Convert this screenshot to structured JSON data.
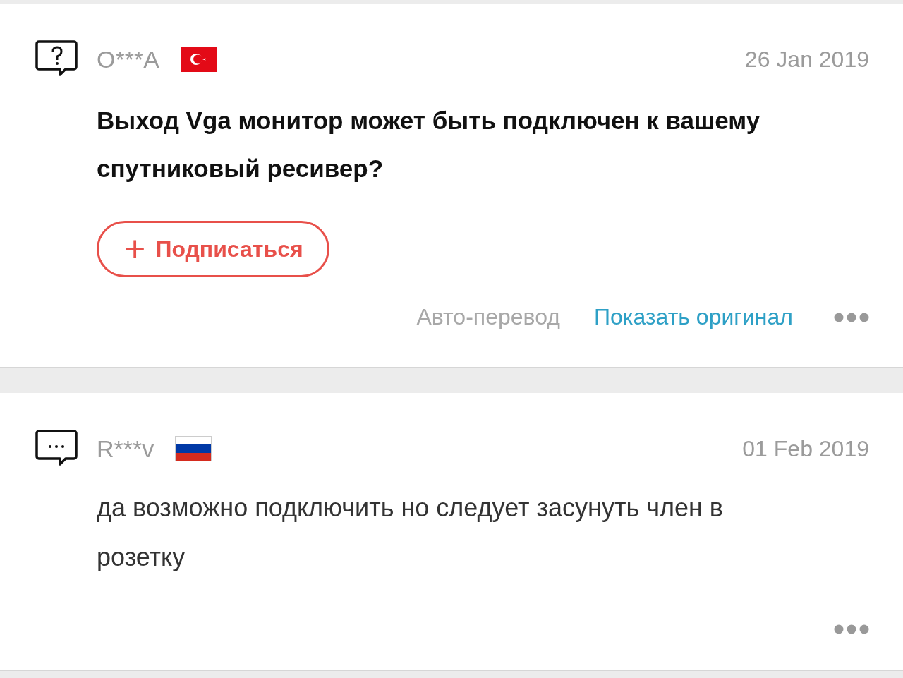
{
  "posts": [
    {
      "kind": "question",
      "author": "O***A",
      "flag": {
        "kind": "tr"
      },
      "date": "26 Jan 2019",
      "text": "Выход Vga монитор может быть подключен к вашему спутниковый ресивер?",
      "subscribe": {
        "icon": "+",
        "label": "Подписаться"
      },
      "translation": {
        "status": "Авто-перевод",
        "link": "Показать оригинал"
      }
    },
    {
      "kind": "answer",
      "author": "R***v",
      "flag": {
        "kind": "ru"
      },
      "date": "01 Feb 2019",
      "text": "да возможно подключить но следует засунуть член в розетку"
    }
  ]
}
